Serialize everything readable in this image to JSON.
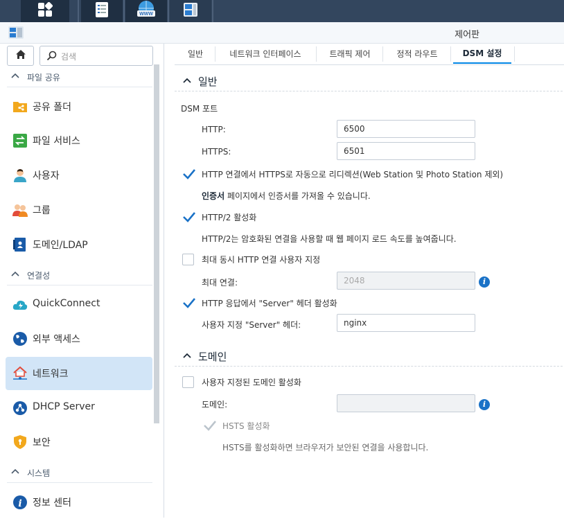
{
  "window": {
    "title": "제어판"
  },
  "search": {
    "placeholder": "검색"
  },
  "sidebar": {
    "sections": [
      {
        "label": "파일 공유"
      },
      {
        "label": "연결성"
      },
      {
        "label": "시스템"
      }
    ],
    "items": [
      {
        "label": "공유 폴더",
        "icon": "shared-folder-icon"
      },
      {
        "label": "파일 서비스",
        "icon": "file-services-icon"
      },
      {
        "label": "사용자",
        "icon": "user-icon"
      },
      {
        "label": "그룹",
        "icon": "group-icon"
      },
      {
        "label": "도메인/LDAP",
        "icon": "domain-ldap-icon"
      },
      {
        "label": "QuickConnect",
        "icon": "quickconnect-icon"
      },
      {
        "label": "외부 액세스",
        "icon": "external-access-icon"
      },
      {
        "label": "네트워크",
        "icon": "network-icon",
        "active": true
      },
      {
        "label": "DHCP Server",
        "icon": "dhcp-server-icon"
      },
      {
        "label": "보안",
        "icon": "security-shield-icon"
      },
      {
        "label": "정보 센터",
        "icon": "info-center-icon"
      }
    ]
  },
  "tabs": [
    {
      "label": "일반"
    },
    {
      "label": "네트워크 인터페이스"
    },
    {
      "label": "트래픽 제어"
    },
    {
      "label": "정적 라우트"
    },
    {
      "label": "DSM 설정",
      "active": true
    }
  ],
  "general": {
    "title": "일반",
    "dsm_port_label": "DSM 포트",
    "http_label": "HTTP:",
    "http_value": "6500",
    "https_label": "HTTPS:",
    "https_value": "6501",
    "redirect_label": "HTTP 연결에서 HTTPS로 자동으로 리디렉션(Web Station 및 Photo Station 제외)",
    "redirect_checked": true,
    "cert_link": "인증서",
    "cert_note": " 페이지에서 인증서를 가져올 수 있습니다.",
    "http2_label": "HTTP/2 활성화",
    "http2_checked": true,
    "http2_note": "HTTP/2는 암호화된 연결을 사용할 때 웹 페이지 로드 속도를 높여줍니다.",
    "maxconn_label": "최대 동시 HTTP 연결 사용자 지정",
    "maxconn_checked": false,
    "maxconn_field_label": "최대 연결:",
    "maxconn_value": "2048",
    "server_header_label": "HTTP 응답에서 \"Server\" 헤더 활성화",
    "server_header_checked": true,
    "custom_header_label": "사용자 지정 \"Server\" 헤더:",
    "custom_header_value": "nginx"
  },
  "domain": {
    "title": "도메인",
    "custom_domain_label": "사용자 지정된 도메인 활성화",
    "custom_domain_checked": false,
    "domain_field_label": "도메인:",
    "domain_value": "",
    "hsts_label": "HSTS 활성화",
    "hsts_checked": true,
    "hsts_disabled": true,
    "hsts_note": "HSTS를 활성화하면 브라우저가 보안된 연결을 사용합니다."
  },
  "colors": {
    "accent": "#0086e5",
    "active_item": "#d2e5f7",
    "taskbar": "#33465e",
    "link": "#1d2a38"
  }
}
